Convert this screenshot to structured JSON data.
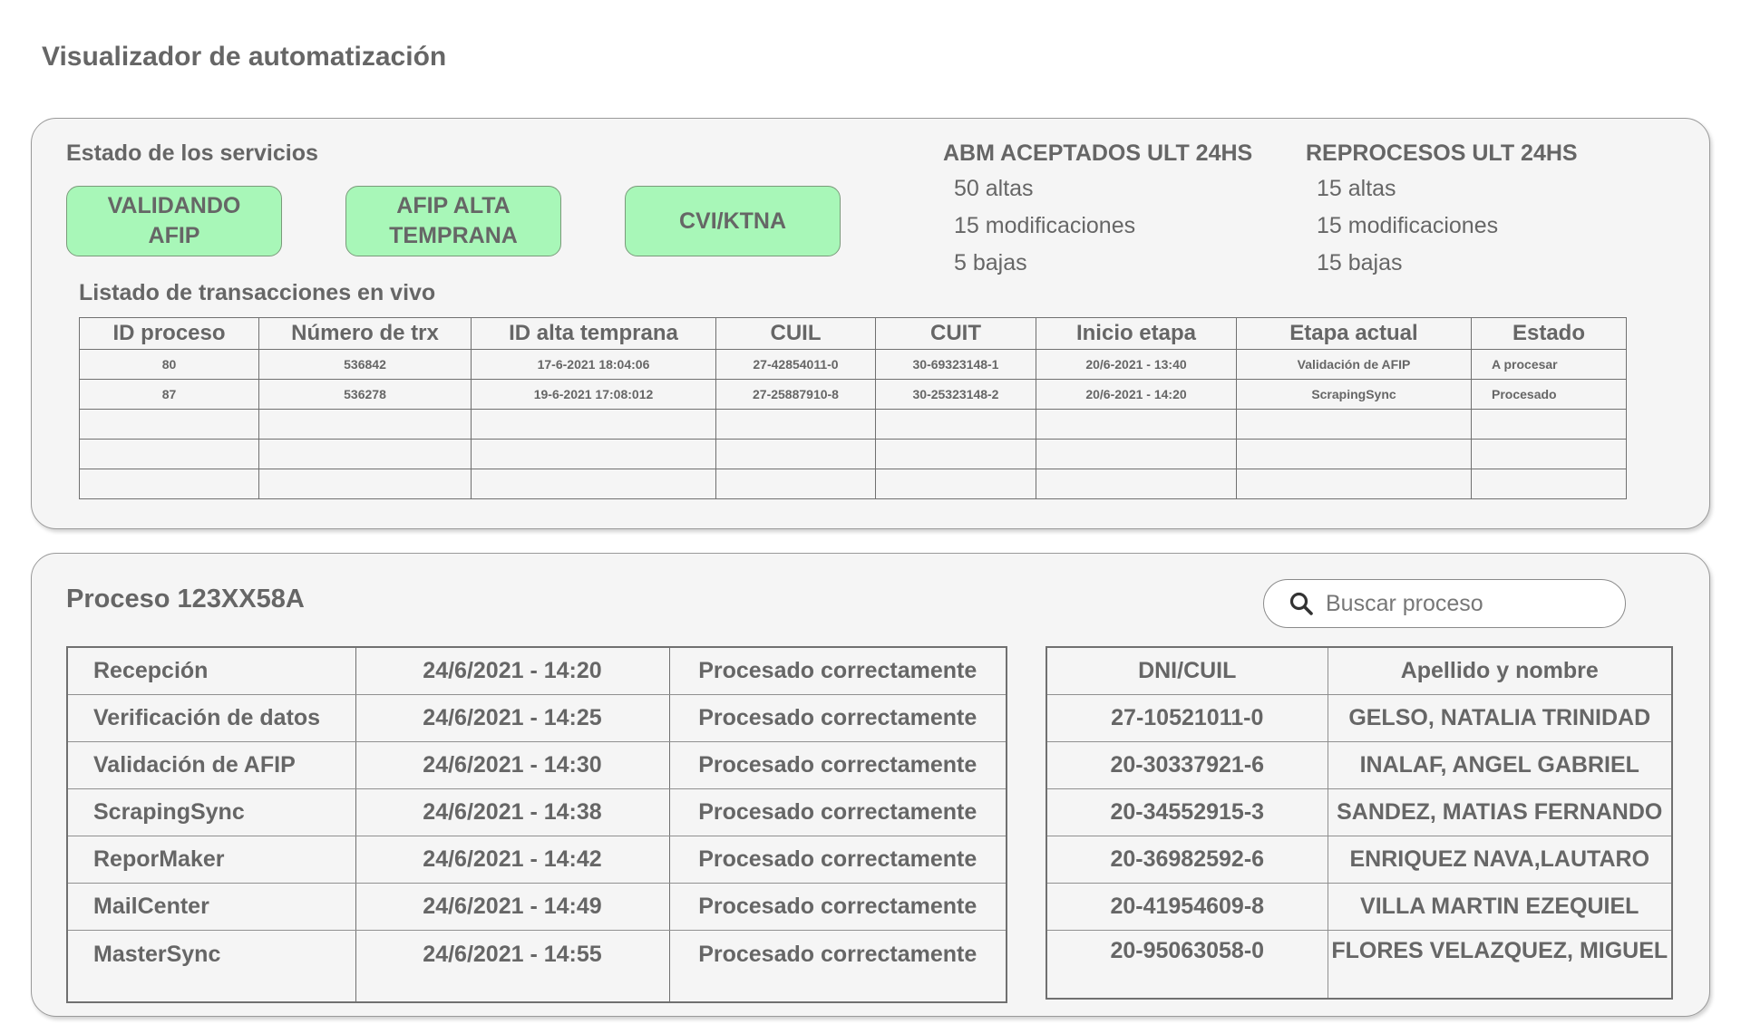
{
  "app": {
    "title": "Visualizador de automatización"
  },
  "services": {
    "title": "Estado de los servicios",
    "items": [
      {
        "line1": "VALIDANDO",
        "line2": "AFIP"
      },
      {
        "line1": "AFIP ALTA",
        "line2": "TEMPRANA"
      },
      {
        "line1": "CVI/KTNA",
        "line2": ""
      }
    ],
    "status_color": "#a8f7b8"
  },
  "abm": {
    "title": "ABM ACEPTADOS ULT 24HS",
    "lines": [
      "50 altas",
      "15 modificaciones",
      "5 bajas"
    ]
  },
  "reprocesos": {
    "title": "REPROCESOS ULT 24HS",
    "lines": [
      "15 altas",
      "15 modificaciones",
      "15 bajas"
    ]
  },
  "transactions": {
    "title": "Listado de transacciones en vivo",
    "headers": [
      "ID proceso",
      "Número de trx",
      "ID alta temprana",
      "CUIL",
      "CUIT",
      "Inicio etapa",
      "Etapa actual",
      "Estado"
    ],
    "rows": [
      [
        "80",
        "536842",
        "17-6-2021 18:04:06",
        "27-42854011-0",
        "30-69323148-1",
        "20/6-2021 - 13:40",
        "Validación de AFIP",
        "A procesar"
      ],
      [
        "87",
        "536278",
        "19-6-2021 17:08:012",
        "27-25887910-8",
        "30-25323148-2",
        "20/6-2021 - 14:20",
        "ScrapingSync",
        "Procesado"
      ]
    ]
  },
  "process": {
    "title": "Proceso 123XX58A",
    "search_placeholder": "Buscar proceso",
    "stages": [
      [
        "Recepción",
        "24/6/2021 - 14:20",
        "Procesado correctamente"
      ],
      [
        "Verificación de datos",
        "24/6/2021 - 14:25",
        "Procesado correctamente"
      ],
      [
        "Validación de AFIP",
        "24/6/2021 - 14:30",
        "Procesado correctamente"
      ],
      [
        "ScrapingSync",
        "24/6/2021 - 14:38",
        "Procesado correctamente"
      ],
      [
        "ReporMaker",
        "24/6/2021 - 14:42",
        "Procesado correctamente"
      ],
      [
        "MailCenter",
        "24/6/2021 - 14:49",
        "Procesado correctamente"
      ],
      [
        "MasterSync",
        "24/6/2021 - 14:55",
        "Procesado correctamente"
      ]
    ],
    "persons_headers": [
      "DNI/CUIL",
      "Apellido y nombre"
    ],
    "persons": [
      [
        "27-10521011-0",
        "GELSO, NATALIA TRINIDAD"
      ],
      [
        "20-30337921-6",
        "INALAF, ANGEL GABRIEL"
      ],
      [
        "20-34552915-3",
        "SANDEZ, MATIAS FERNANDO"
      ],
      [
        "20-36982592-6",
        "ENRIQUEZ NAVA,LAUTARO"
      ],
      [
        "20-41954609-8",
        "VILLA MARTIN EZEQUIEL"
      ],
      [
        "20-95063058-0",
        "FLORES VELAZQUEZ, MIGUEL"
      ]
    ]
  }
}
